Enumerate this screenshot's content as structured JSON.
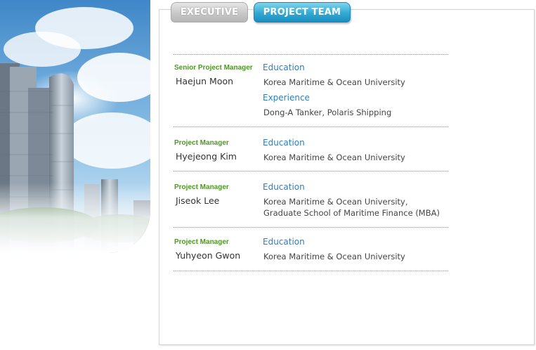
{
  "tabs": {
    "executive": "EXECUTIVE",
    "project_team": "PROJECT TEAM",
    "active": "project_team"
  },
  "members": [
    {
      "role": "Senior Project Manager",
      "name": "Haejun Moon",
      "sections": [
        {
          "heading": "Education",
          "lines": [
            "Korea Maritime & Ocean University"
          ]
        },
        {
          "heading": "Experience",
          "lines": [
            "Dong-A Tanker, Polaris Shipping"
          ]
        }
      ]
    },
    {
      "role": "Project Manager",
      "name": "Hyejeong Kim",
      "sections": [
        {
          "heading": "Education",
          "lines": [
            "Korea Maritime & Ocean University"
          ]
        }
      ]
    },
    {
      "role": "Project Manager",
      "name": "Jiseok Lee",
      "sections": [
        {
          "heading": "Education",
          "lines": [
            "Korea Maritime & Ocean University,",
            "Graduate School of Maritime Finance (MBA)"
          ]
        }
      ]
    },
    {
      "role": "Project Manager",
      "name": "Yuhyeon Gwon",
      "sections": [
        {
          "heading": "Education",
          "lines": [
            "Korea Maritime & Ocean University"
          ]
        }
      ]
    }
  ],
  "colors": {
    "role": "#4a9a1c",
    "heading": "#2a7fbf",
    "active_tab": "#33a9d2",
    "inactive_tab": "#c8c8c8"
  }
}
